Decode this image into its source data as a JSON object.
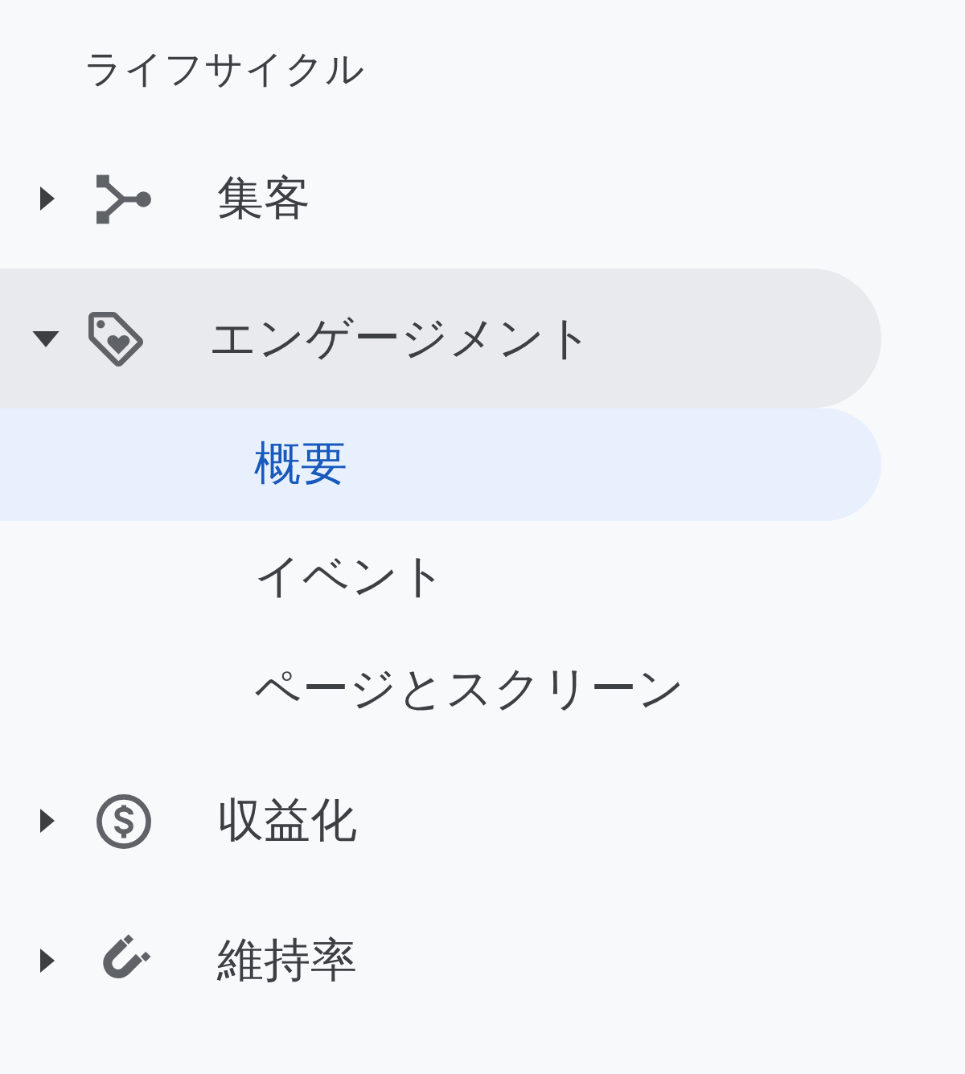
{
  "sidebar": {
    "section_title": "ライフサイクル",
    "items": [
      {
        "label": "集客",
        "expanded": false,
        "selected": false
      },
      {
        "label": "エンゲージメント",
        "expanded": true,
        "selected": true,
        "children": [
          {
            "label": "概要",
            "selected": true
          },
          {
            "label": "イベント",
            "selected": false
          },
          {
            "label": "ページとスクリーン",
            "selected": false
          }
        ]
      },
      {
        "label": "収益化",
        "expanded": false,
        "selected": false
      },
      {
        "label": "維持率",
        "expanded": false,
        "selected": false
      }
    ]
  }
}
